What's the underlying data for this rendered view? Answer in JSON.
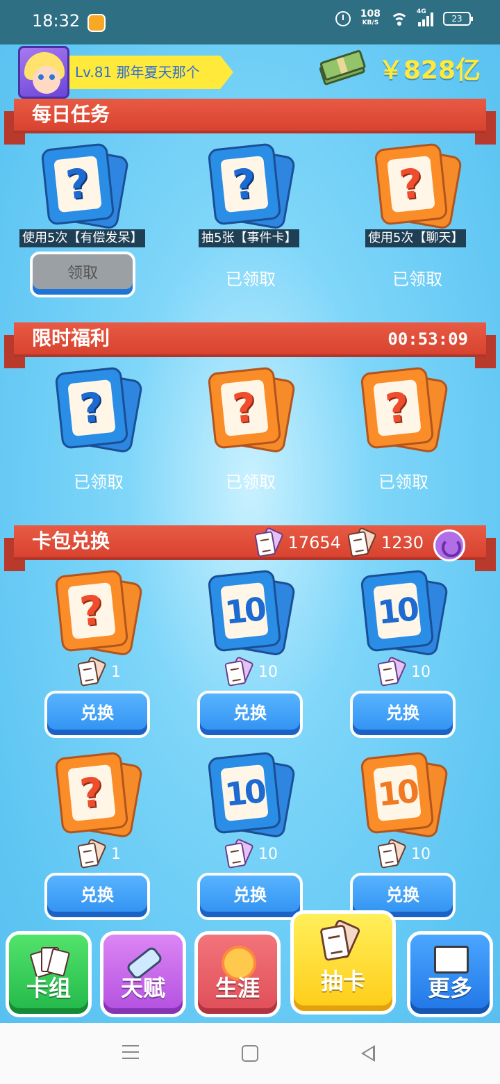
{
  "status_bar": {
    "time": "18:32",
    "speed_value": "108",
    "speed_unit": "KB/S",
    "network": "4G",
    "battery": "23"
  },
  "player": {
    "level_name": "Lv.81 那年夏天那个",
    "money": "￥828亿"
  },
  "daily_tasks": {
    "title": "每日任务",
    "items": [
      {
        "card_color": "blue",
        "card_symbol": "?",
        "label": "使用5次【有偿发呆】",
        "status": "领取"
      },
      {
        "card_color": "blue",
        "card_symbol": "?",
        "label": "抽5张【事件卡】",
        "status": "已领取"
      },
      {
        "card_color": "orange",
        "card_symbol": "?",
        "label": "使用5次【聊天】",
        "status": "已领取"
      }
    ]
  },
  "limited_offer": {
    "title": "限时福利",
    "timer": "00:53:09",
    "items": [
      {
        "card_color": "blue",
        "card_symbol": "?",
        "status": "已领取"
      },
      {
        "card_color": "orange",
        "card_symbol": "?",
        "status": "已领取"
      },
      {
        "card_color": "orange",
        "card_symbol": "?",
        "status": "已领取"
      }
    ]
  },
  "pack_exchange": {
    "title": "卡包兑换",
    "purple_tickets": "17654",
    "brown_tickets": "1230",
    "button_label": "兑换",
    "items": [
      {
        "card_color": "orange",
        "card_symbol": "?",
        "ticket": "brown",
        "cost": "1"
      },
      {
        "card_color": "blue",
        "card_symbol": "10",
        "ticket": "purple",
        "cost": "10"
      },
      {
        "card_color": "blue",
        "card_symbol": "10",
        "ticket": "purple",
        "cost": "10"
      },
      {
        "card_color": "orange",
        "card_symbol": "?",
        "ticket": "brown",
        "cost": "1"
      },
      {
        "card_color": "blue",
        "card_symbol": "10",
        "ticket": "purple",
        "cost": "10"
      },
      {
        "card_color": "orange",
        "card_symbol": "10",
        "ticket": "brown",
        "cost": "10"
      }
    ]
  },
  "bottom_nav": {
    "deck": "卡组",
    "talent": "天赋",
    "career": "生涯",
    "draw": "抽卡",
    "more": "更多"
  },
  "colors": {
    "header_red": "#d8432f",
    "sky_blue": "#5fc6f3",
    "money_yellow": "#ffe93a",
    "card_blue": "#2a8de6",
    "card_orange": "#fb8d28"
  }
}
